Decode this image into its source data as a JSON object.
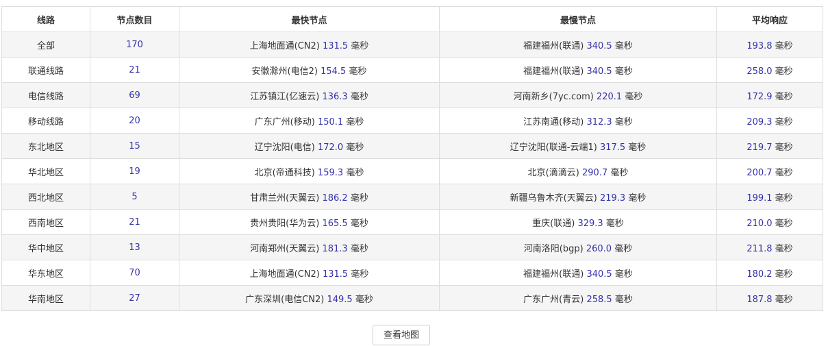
{
  "table": {
    "headers": [
      "线路",
      "节点数目",
      "最快节点",
      "最慢节点",
      "平均响应"
    ],
    "unit": "毫秒",
    "rows": [
      {
        "line": "全部",
        "count": "170",
        "fast_name": "上海地面通(CN2)",
        "fast_ms": "131.5",
        "slow_name": "福建福州(联通)",
        "slow_ms": "340.5",
        "avg_ms": "193.8"
      },
      {
        "line": "联通线路",
        "count": "21",
        "fast_name": "安徽滁州(电信2)",
        "fast_ms": "154.5",
        "slow_name": "福建福州(联通)",
        "slow_ms": "340.5",
        "avg_ms": "258.0"
      },
      {
        "line": "电信线路",
        "count": "69",
        "fast_name": "江苏镇江(亿速云)",
        "fast_ms": "136.3",
        "slow_name": "河南新乡(7yc.com)",
        "slow_ms": "220.1",
        "avg_ms": "172.9"
      },
      {
        "line": "移动线路",
        "count": "20",
        "fast_name": "广东广州(移动)",
        "fast_ms": "150.1",
        "slow_name": "江苏南通(移动)",
        "slow_ms": "312.3",
        "avg_ms": "209.3"
      },
      {
        "line": "东北地区",
        "count": "15",
        "fast_name": "辽宁沈阳(电信)",
        "fast_ms": "172.0",
        "slow_name": "辽宁沈阳(联通-云端1)",
        "slow_ms": "317.5",
        "avg_ms": "219.7"
      },
      {
        "line": "华北地区",
        "count": "19",
        "fast_name": "北京(帝通科技)",
        "fast_ms": "159.3",
        "slow_name": "北京(滴滴云)",
        "slow_ms": "290.7",
        "avg_ms": "200.7"
      },
      {
        "line": "西北地区",
        "count": "5",
        "fast_name": "甘肃兰州(天翼云)",
        "fast_ms": "186.2",
        "slow_name": "新疆乌鲁木齐(天翼云)",
        "slow_ms": "219.3",
        "avg_ms": "199.1"
      },
      {
        "line": "西南地区",
        "count": "21",
        "fast_name": "贵州贵阳(华为云)",
        "fast_ms": "165.5",
        "slow_name": "重庆(联通)",
        "slow_ms": "329.3",
        "avg_ms": "210.0"
      },
      {
        "line": "华中地区",
        "count": "13",
        "fast_name": "河南郑州(天翼云)",
        "fast_ms": "181.3",
        "slow_name": "河南洛阳(bgp)",
        "slow_ms": "260.0",
        "avg_ms": "211.8"
      },
      {
        "line": "华东地区",
        "count": "70",
        "fast_name": "上海地面通(CN2)",
        "fast_ms": "131.5",
        "slow_name": "福建福州(联通)",
        "slow_ms": "340.5",
        "avg_ms": "180.2"
      },
      {
        "line": "华南地区",
        "count": "27",
        "fast_name": "广东深圳(电信CN2)",
        "fast_ms": "149.5",
        "slow_name": "广东广州(青云)",
        "slow_ms": "258.5",
        "avg_ms": "187.8"
      }
    ]
  },
  "button": {
    "label": "查看地图"
  },
  "colors": {
    "number": "#3333aa",
    "text": "#333333",
    "stripe": "#f5f5f5",
    "border": "#dddddd"
  }
}
